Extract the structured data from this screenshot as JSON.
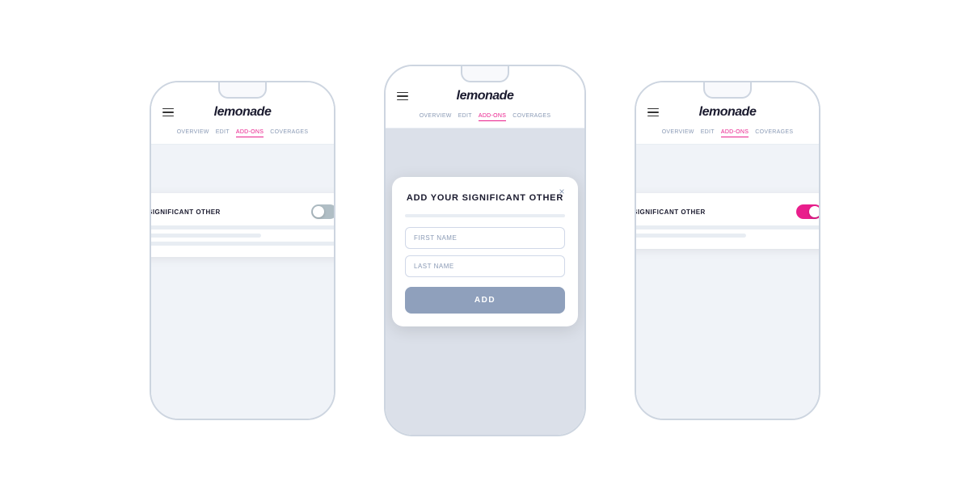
{
  "phones": {
    "left": {
      "logo": "lemonade",
      "nav": [
        "OVERVIEW",
        "EDIT",
        "ADD-ONS",
        "COVERAGES"
      ],
      "active_nav": "ADD-ONS",
      "card": {
        "title": "SIGNIFICANT OTHER",
        "toggle_state": "off"
      }
    },
    "center": {
      "logo": "lemonade",
      "nav": [
        "OVERVIEW",
        "EDIT",
        "ADD-ONS",
        "COVERAGES"
      ],
      "active_nav": "ADD-ONS",
      "modal": {
        "title": "ADD YOUR SIGNIFICANT OTHER",
        "close_label": "×",
        "first_name_placeholder": "FIRST NAME",
        "last_name_placeholder": "LAST NAME",
        "button_label": "ADD"
      }
    },
    "right": {
      "logo": "lemonade",
      "nav": [
        "OVERVIEW",
        "EDIT",
        "ADD-ONS",
        "COVERAGES"
      ],
      "active_nav": "ADD-ONS",
      "card": {
        "title": "SIGNIFICANT OTHER",
        "toggle_state": "on"
      }
    }
  },
  "bottom_indicator": true
}
